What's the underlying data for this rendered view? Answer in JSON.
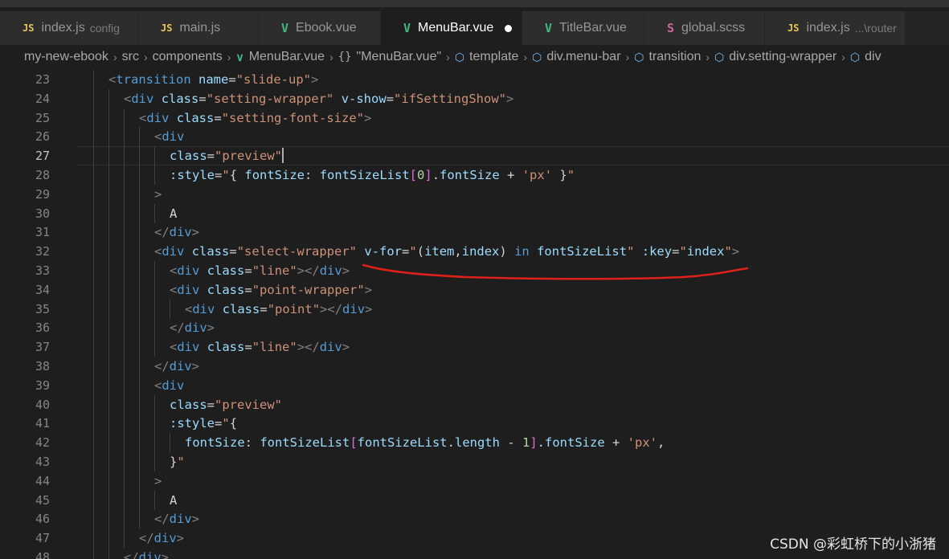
{
  "tabs": [
    {
      "icon": "JS",
      "icon_type": "js",
      "label": "index.js",
      "sub": "config",
      "active": false
    },
    {
      "icon": "JS",
      "icon_type": "js",
      "label": "main.js",
      "sub": "",
      "active": false
    },
    {
      "icon": "V",
      "icon_type": "vue",
      "label": "Ebook.vue",
      "sub": "",
      "active": false
    },
    {
      "icon": "V",
      "icon_type": "vue",
      "label": "MenuBar.vue",
      "sub": "",
      "active": true,
      "modified": true
    },
    {
      "icon": "V",
      "icon_type": "vue",
      "label": "TitleBar.vue",
      "sub": "",
      "active": false
    },
    {
      "icon": "S",
      "icon_type": "scss",
      "label": "global.scss",
      "sub": "",
      "active": false
    },
    {
      "icon": "JS",
      "icon_type": "js",
      "label": "index.js",
      "sub": "...\\router",
      "active": false
    }
  ],
  "breadcrumb": [
    {
      "text": "my-new-ebook",
      "icon": ""
    },
    {
      "text": "src",
      "icon": ""
    },
    {
      "text": "components",
      "icon": ""
    },
    {
      "text": "MenuBar.vue",
      "icon": "vue"
    },
    {
      "text": "\"MenuBar.vue\"",
      "icon": "brace"
    },
    {
      "text": "template",
      "icon": "cube"
    },
    {
      "text": "div.menu-bar",
      "icon": "cube"
    },
    {
      "text": "transition",
      "icon": "cube"
    },
    {
      "text": "div.setting-wrapper",
      "icon": "cube"
    },
    {
      "text": "div",
      "icon": "cube"
    }
  ],
  "editor": {
    "current_line": 27,
    "lines": [
      {
        "n": 23,
        "indent": 2,
        "tokens": [
          [
            "pun",
            "<"
          ],
          [
            "tag",
            "transition"
          ],
          [
            "txt",
            " "
          ],
          [
            "attr",
            "name"
          ],
          [
            "eq",
            "="
          ],
          [
            "str",
            "\"slide-up\""
          ],
          [
            "pun",
            ">"
          ]
        ]
      },
      {
        "n": 24,
        "indent": 3,
        "tokens": [
          [
            "pun",
            "<"
          ],
          [
            "tag",
            "div"
          ],
          [
            "txt",
            " "
          ],
          [
            "attr",
            "class"
          ],
          [
            "eq",
            "="
          ],
          [
            "str",
            "\"setting-wrapper\""
          ],
          [
            "txt",
            " "
          ],
          [
            "attr",
            "v-show"
          ],
          [
            "eq",
            "="
          ],
          [
            "str",
            "\"ifSettingShow\""
          ],
          [
            "pun",
            ">"
          ]
        ]
      },
      {
        "n": 25,
        "indent": 4,
        "tokens": [
          [
            "pun",
            "<"
          ],
          [
            "tag",
            "div"
          ],
          [
            "txt",
            " "
          ],
          [
            "attr",
            "class"
          ],
          [
            "eq",
            "="
          ],
          [
            "str",
            "\"setting-font-size\""
          ],
          [
            "pun",
            ">"
          ]
        ]
      },
      {
        "n": 26,
        "indent": 5,
        "tokens": [
          [
            "pun",
            "<"
          ],
          [
            "tag",
            "div"
          ]
        ]
      },
      {
        "n": 27,
        "indent": 6,
        "caret": true,
        "tokens": [
          [
            "attr",
            "class"
          ],
          [
            "eq",
            "="
          ],
          [
            "str",
            "\"preview\""
          ]
        ]
      },
      {
        "n": 28,
        "indent": 6,
        "tokens": [
          [
            "attr",
            ":style"
          ],
          [
            "eq",
            "="
          ],
          [
            "str",
            "\""
          ],
          [
            "txt",
            "{ "
          ],
          [
            "var",
            "fontSize"
          ],
          [
            "txt",
            ": "
          ],
          [
            "var",
            "fontSizeList"
          ],
          [
            "br",
            "["
          ],
          [
            "num",
            "0"
          ],
          [
            "br",
            "]"
          ],
          [
            "txt",
            "."
          ],
          [
            "var",
            "fontSize"
          ],
          [
            "txt",
            " + "
          ],
          [
            "str",
            "'px'"
          ],
          [
            "txt",
            " }"
          ],
          [
            "str",
            "\""
          ]
        ]
      },
      {
        "n": 29,
        "indent": 5,
        "tokens": [
          [
            "pun",
            ">"
          ]
        ]
      },
      {
        "n": 30,
        "indent": 6,
        "tokens": [
          [
            "txt",
            "A"
          ]
        ]
      },
      {
        "n": 31,
        "indent": 5,
        "tokens": [
          [
            "pun",
            "</"
          ],
          [
            "tag",
            "div"
          ],
          [
            "pun",
            ">"
          ]
        ]
      },
      {
        "n": 32,
        "indent": 5,
        "tokens": [
          [
            "pun",
            "<"
          ],
          [
            "tag",
            "div"
          ],
          [
            "txt",
            " "
          ],
          [
            "attr",
            "class"
          ],
          [
            "eq",
            "="
          ],
          [
            "str",
            "\"select-wrapper\""
          ],
          [
            "txt",
            " "
          ],
          [
            "attr",
            "v-for"
          ],
          [
            "eq",
            "="
          ],
          [
            "str",
            "\""
          ],
          [
            "txt",
            "("
          ],
          [
            "var",
            "item"
          ],
          [
            "txt",
            ","
          ],
          [
            "var",
            "index"
          ],
          [
            "txt",
            ") "
          ],
          [
            "kw",
            "in"
          ],
          [
            "txt",
            " "
          ],
          [
            "var",
            "fontSizeList"
          ],
          [
            "str",
            "\""
          ],
          [
            "txt",
            " "
          ],
          [
            "attr",
            ":key"
          ],
          [
            "eq",
            "="
          ],
          [
            "str",
            "\""
          ],
          [
            "var",
            "index"
          ],
          [
            "str",
            "\""
          ],
          [
            "pun",
            ">"
          ]
        ]
      },
      {
        "n": 33,
        "indent": 6,
        "tokens": [
          [
            "pun",
            "<"
          ],
          [
            "tag",
            "div"
          ],
          [
            "txt",
            " "
          ],
          [
            "attr",
            "class"
          ],
          [
            "eq",
            "="
          ],
          [
            "str",
            "\"line\""
          ],
          [
            "pun",
            "></"
          ],
          [
            "tag",
            "div"
          ],
          [
            "pun",
            ">"
          ]
        ]
      },
      {
        "n": 34,
        "indent": 6,
        "tokens": [
          [
            "pun",
            "<"
          ],
          [
            "tag",
            "div"
          ],
          [
            "txt",
            " "
          ],
          [
            "attr",
            "class"
          ],
          [
            "eq",
            "="
          ],
          [
            "str",
            "\"point-wrapper\""
          ],
          [
            "pun",
            ">"
          ]
        ]
      },
      {
        "n": 35,
        "indent": 7,
        "tokens": [
          [
            "pun",
            "<"
          ],
          [
            "tag",
            "div"
          ],
          [
            "txt",
            " "
          ],
          [
            "attr",
            "class"
          ],
          [
            "eq",
            "="
          ],
          [
            "str",
            "\"point\""
          ],
          [
            "pun",
            "></"
          ],
          [
            "tag",
            "div"
          ],
          [
            "pun",
            ">"
          ]
        ]
      },
      {
        "n": 36,
        "indent": 6,
        "tokens": [
          [
            "pun",
            "</"
          ],
          [
            "tag",
            "div"
          ],
          [
            "pun",
            ">"
          ]
        ]
      },
      {
        "n": 37,
        "indent": 6,
        "tokens": [
          [
            "pun",
            "<"
          ],
          [
            "tag",
            "div"
          ],
          [
            "txt",
            " "
          ],
          [
            "attr",
            "class"
          ],
          [
            "eq",
            "="
          ],
          [
            "str",
            "\"line\""
          ],
          [
            "pun",
            "></"
          ],
          [
            "tag",
            "div"
          ],
          [
            "pun",
            ">"
          ]
        ]
      },
      {
        "n": 38,
        "indent": 5,
        "tokens": [
          [
            "pun",
            "</"
          ],
          [
            "tag",
            "div"
          ],
          [
            "pun",
            ">"
          ]
        ]
      },
      {
        "n": 39,
        "indent": 5,
        "tokens": [
          [
            "pun",
            "<"
          ],
          [
            "tag",
            "div"
          ]
        ]
      },
      {
        "n": 40,
        "indent": 6,
        "tokens": [
          [
            "attr",
            "class"
          ],
          [
            "eq",
            "="
          ],
          [
            "str",
            "\"preview\""
          ]
        ]
      },
      {
        "n": 41,
        "indent": 6,
        "tokens": [
          [
            "attr",
            ":style"
          ],
          [
            "eq",
            "="
          ],
          [
            "str",
            "\""
          ],
          [
            "txt",
            "{"
          ]
        ]
      },
      {
        "n": 42,
        "indent": 7,
        "tokens": [
          [
            "var",
            "fontSize"
          ],
          [
            "txt",
            ": "
          ],
          [
            "var",
            "fontSizeList"
          ],
          [
            "br",
            "["
          ],
          [
            "var",
            "fontSizeList"
          ],
          [
            "txt",
            "."
          ],
          [
            "var",
            "length"
          ],
          [
            "txt",
            " - "
          ],
          [
            "num",
            "1"
          ],
          [
            "br",
            "]"
          ],
          [
            "txt",
            "."
          ],
          [
            "var",
            "fontSize"
          ],
          [
            "txt",
            " + "
          ],
          [
            "str",
            "'px'"
          ],
          [
            "txt",
            ","
          ]
        ]
      },
      {
        "n": 43,
        "indent": 6,
        "tokens": [
          [
            "txt",
            "}"
          ],
          [
            "str",
            "\""
          ]
        ]
      },
      {
        "n": 44,
        "indent": 5,
        "tokens": [
          [
            "pun",
            ">"
          ]
        ]
      },
      {
        "n": 45,
        "indent": 6,
        "tokens": [
          [
            "txt",
            "A"
          ]
        ]
      },
      {
        "n": 46,
        "indent": 5,
        "tokens": [
          [
            "pun",
            "</"
          ],
          [
            "tag",
            "div"
          ],
          [
            "pun",
            ">"
          ]
        ]
      },
      {
        "n": 47,
        "indent": 4,
        "tokens": [
          [
            "pun",
            "</"
          ],
          [
            "tag",
            "div"
          ],
          [
            "pun",
            ">"
          ]
        ]
      },
      {
        "n": 48,
        "indent": 3,
        "tokens": [
          [
            "pun",
            "</"
          ],
          [
            "tag",
            "div"
          ],
          [
            "pun",
            ">"
          ]
        ]
      }
    ]
  },
  "watermark": "CSDN @彩虹桥下的小浙猪",
  "colors": {
    "annotation": "#e0201b",
    "active_tab": "#1e1e1e",
    "tab_bg": "#2d2d2d"
  }
}
